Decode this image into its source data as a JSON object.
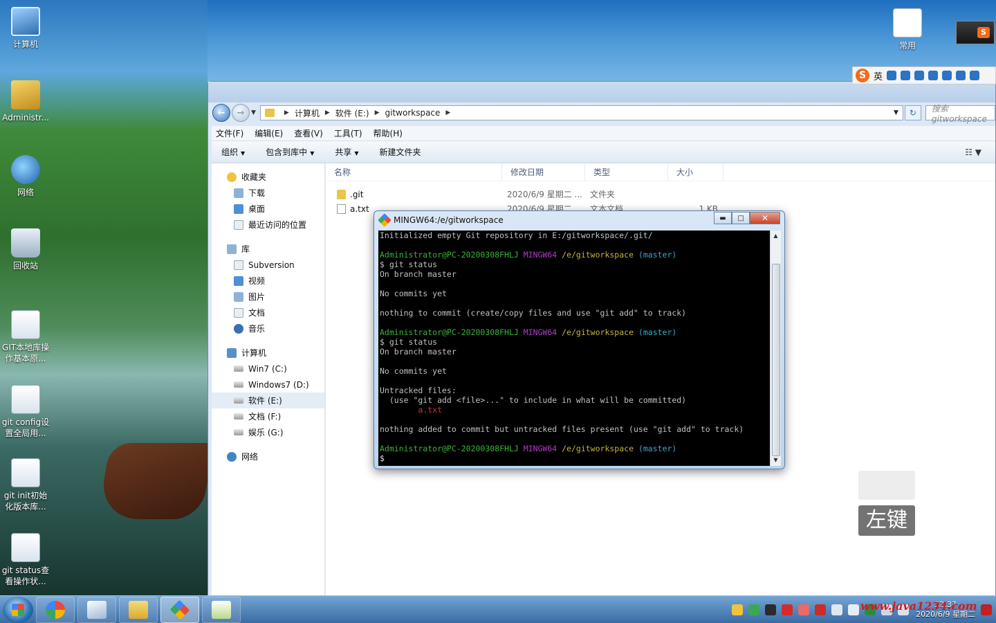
{
  "desktop": {
    "icons": [
      {
        "label": "计算机",
        "icon": "computer-icon"
      },
      {
        "label": "Administr...",
        "icon": "user-folder-icon"
      },
      {
        "label": "网络",
        "icon": "network-icon"
      },
      {
        "label": "回收站",
        "icon": "recycle-bin-icon"
      },
      {
        "label": "GIT本地库操作基本原...",
        "icon": "document-icon"
      },
      {
        "label": "git config设置全局用...",
        "icon": "document-icon"
      },
      {
        "label": "git init初始化版本库...",
        "icon": "document-icon"
      },
      {
        "label": "git status查看操作状...",
        "icon": "document-icon"
      }
    ],
    "right_icon": {
      "label": "常用",
      "icon": "shortcut-file-icon"
    }
  },
  "ime": {
    "mode": "英",
    "logo": "S"
  },
  "explorer": {
    "address": {
      "segments": [
        "计算机",
        "软件 (E:)",
        "gitworkspace"
      ]
    },
    "search_placeholder": "搜索 gitworkspace",
    "menu": [
      "文件(F)",
      "编辑(E)",
      "查看(V)",
      "工具(T)",
      "帮助(H)"
    ],
    "commands": [
      {
        "label": "组织",
        "dropdown": true
      },
      {
        "label": "包含到库中",
        "dropdown": true
      },
      {
        "label": "共享",
        "dropdown": true
      },
      {
        "label": "新建文件夹",
        "dropdown": false
      }
    ],
    "nav": {
      "favorites": {
        "label": "收藏夹",
        "items": [
          "下载",
          "桌面",
          "最近访问的位置"
        ]
      },
      "libraries": {
        "label": "库",
        "items": [
          "Subversion",
          "视频",
          "图片",
          "文档",
          "音乐"
        ]
      },
      "computer": {
        "label": "计算机",
        "items": [
          "Win7 (C:)",
          "Windows7 (D:)",
          "软件 (E:)",
          "文档 (F:)",
          "娱乐 (G:)"
        ],
        "selected": "软件 (E:)"
      },
      "network": {
        "label": "网络"
      }
    },
    "columns": [
      "名称",
      "修改日期",
      "类型",
      "大小"
    ],
    "files": [
      {
        "name": ".git",
        "date": "2020/6/9 星期二 ...",
        "type": "文件夹",
        "size": "",
        "kind": "folder"
      },
      {
        "name": "a.txt",
        "date": "2020/6/9 星期二 ...",
        "type": "文本文档",
        "size": "1 KB",
        "kind": "txt"
      }
    ]
  },
  "terminal": {
    "title": "MINGW64:/e/gitworkspace",
    "prompt_user": "Administrator@PC-20200308FHLJ",
    "prompt_env": "MINGW64",
    "prompt_path": "/e/gitworkspace",
    "prompt_branch": "(master)",
    "lines": {
      "l1": "Initialized empty Git repository in E:/gitworkspace/.git/",
      "cmd_status": "$ git status",
      "on_branch": "On branch master",
      "no_commits": "No commits yet",
      "nothing_commit": "nothing to commit (create/copy files and use \"git add\" to track)",
      "untracked": "Untracked files:",
      "use_add": "  (use \"git add <file>...\" to include in what will be committed)",
      "file": "        a.txt",
      "nothing_added": "nothing added to commit but untracked files present (use \"git add\" to track)",
      "dollar": "$"
    }
  },
  "key_hint": {
    "label": "左键"
  },
  "taskbar": {
    "clock_time": "22:37",
    "clock_date": "2020/6/9 星期二",
    "watermark": "www.java1234.com"
  }
}
